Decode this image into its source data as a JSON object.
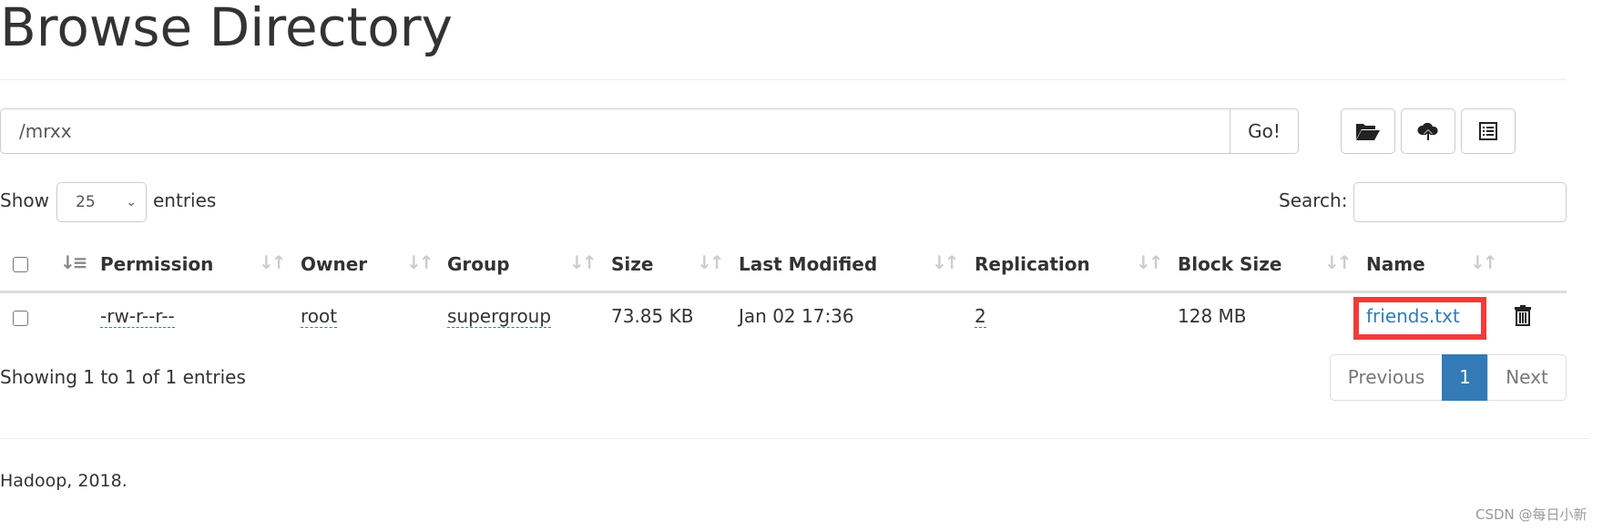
{
  "title": "Browse Directory",
  "path": {
    "value": "/mrxx",
    "go_label": "Go!"
  },
  "toolbar": {
    "icons": [
      "folder-open-icon",
      "cloud-upload-icon",
      "list-alt-icon"
    ]
  },
  "length": {
    "show": "Show",
    "value": "25",
    "entries": "entries"
  },
  "search": {
    "label": "Search:",
    "value": ""
  },
  "columns": [
    "Permission",
    "Owner",
    "Group",
    "Size",
    "Last Modified",
    "Replication",
    "Block Size",
    "Name"
  ],
  "rows": [
    {
      "permission": "-rw-r--r--",
      "owner": "root",
      "group": "supergroup",
      "size": "73.85 KB",
      "modified": "Jan 02 17:36",
      "replication": "2",
      "block_size": "128 MB",
      "name": "friends.txt"
    }
  ],
  "info": "Showing 1 to 1 of 1 entries",
  "pagination": {
    "previous": "Previous",
    "current": "1",
    "next": "Next"
  },
  "footer": "Hadoop, 2018.",
  "watermark": "CSDN @每日小新",
  "colors": {
    "link": "#337ab7",
    "highlight": "#f33a3a",
    "active_page": "#337ab7"
  }
}
